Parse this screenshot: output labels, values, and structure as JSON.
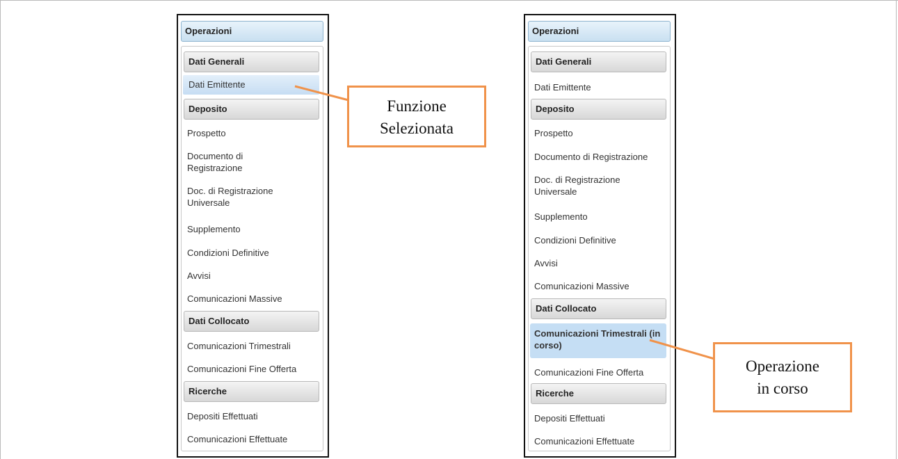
{
  "panels": [
    {
      "header": "Operazioni",
      "sections": [
        {
          "title": "Dati Generali",
          "items": [
            {
              "label": "Dati Emittente",
              "state": "selected"
            }
          ]
        },
        {
          "title": "Deposito",
          "items": [
            {
              "label": "Prospetto"
            },
            {
              "label": "Documento di Registrazione"
            },
            {
              "label": "Doc. di Registrazione Universale"
            },
            {
              "label": "Supplemento"
            },
            {
              "label": "Condizioni Definitive"
            },
            {
              "label": "Avvisi"
            },
            {
              "label": "Comunicazioni Massive"
            }
          ]
        },
        {
          "title": "Dati Collocato",
          "items": [
            {
              "label": "Comunicazioni Trimestrali"
            },
            {
              "label": "Comunicazioni Fine Offerta"
            }
          ]
        },
        {
          "title": "Ricerche",
          "items": [
            {
              "label": "Depositi Effettuati"
            },
            {
              "label": "Comunicazioni Effettuate"
            }
          ]
        }
      ]
    },
    {
      "header": "Operazioni",
      "sections": [
        {
          "title": "Dati Generali",
          "items": [
            {
              "label": "Dati Emittente"
            }
          ]
        },
        {
          "title": "Deposito",
          "items": [
            {
              "label": "Prospetto"
            },
            {
              "label": "Documento di Registrazione"
            },
            {
              "label": "Doc. di Registrazione Universale"
            },
            {
              "label": "Supplemento"
            },
            {
              "label": "Condizioni Definitive"
            },
            {
              "label": "Avvisi"
            },
            {
              "label": "Comunicazioni Massive"
            }
          ]
        },
        {
          "title": "Dati Collocato",
          "items": [
            {
              "label": "Comunicazioni Trimestrali (in corso)",
              "state": "active"
            },
            {
              "label": "Comunicazioni Fine Offerta"
            }
          ]
        },
        {
          "title": "Ricerche",
          "items": [
            {
              "label": "Depositi Effettuati"
            },
            {
              "label": "Comunicazioni Effettuate"
            }
          ]
        }
      ]
    }
  ],
  "callouts": {
    "selected": {
      "line1": "Funzione",
      "line2": "Selezionata"
    },
    "in_progress": {
      "line1": "Operazione",
      "line2": "in corso"
    }
  },
  "colors": {
    "callout_border": "#f0924a",
    "selected_bg": "#d6e7f7",
    "active_bg": "#c5def4"
  }
}
